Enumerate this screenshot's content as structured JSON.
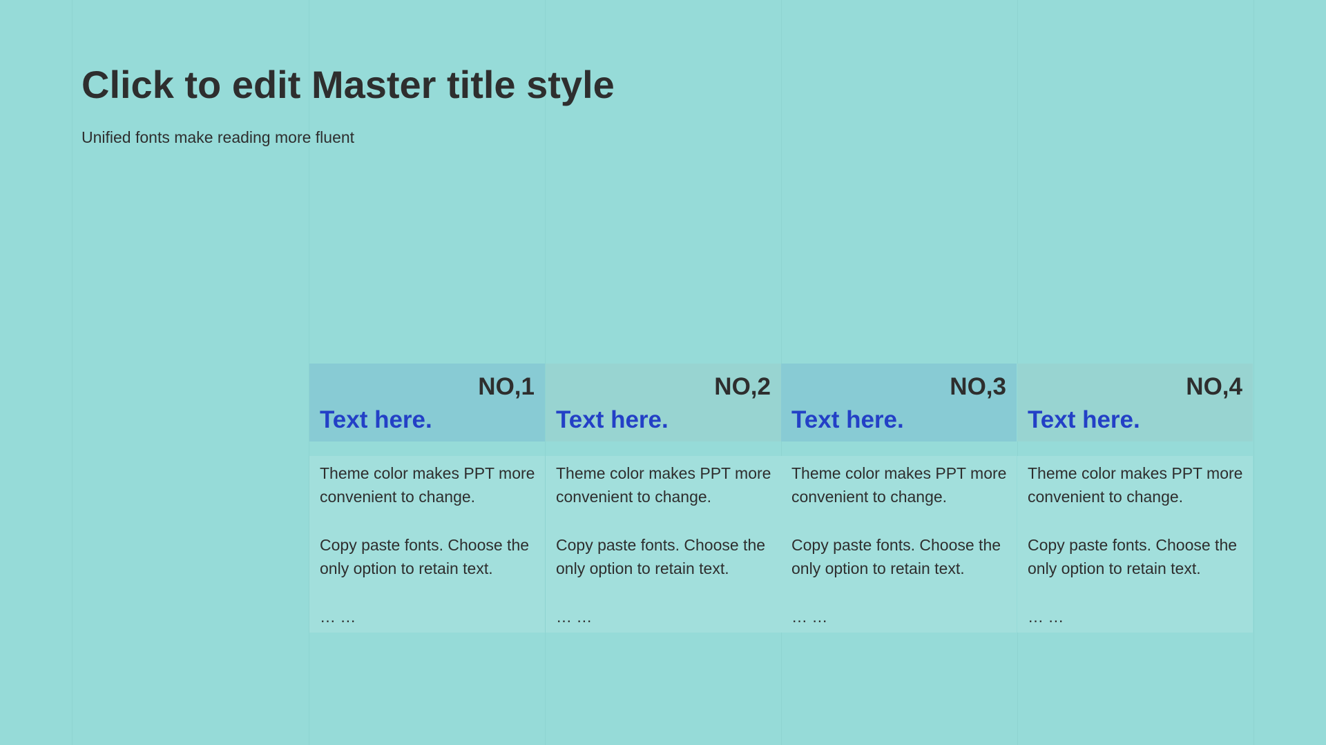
{
  "slide": {
    "title": "Click to edit Master title style",
    "subtitle": "Unified fonts make reading more fluent"
  },
  "cards": [
    {
      "number": "NO,1",
      "heading": "Text here.",
      "paragraph1": "Theme  color makes PPT more convenient to change.",
      "paragraph2": "Copy paste  fonts. Choose the only option to retain text.",
      "ellipsis": "… …"
    },
    {
      "number": "NO,2",
      "heading": "Text here.",
      "paragraph1": "Theme  color makes PPT more convenient to change.",
      "paragraph2": "Copy paste  fonts. Choose the only option to retain text.",
      "ellipsis": "… …"
    },
    {
      "number": "NO,3",
      "heading": "Text here.",
      "paragraph1": "Theme  color makes PPT more convenient to change.",
      "paragraph2": "Copy paste  fonts. Choose the only option to retain text.",
      "ellipsis": "… …"
    },
    {
      "number": "NO,4",
      "heading": "Text here.",
      "paragraph1": "Theme  color makes PPT more convenient to change.",
      "paragraph2": "Copy paste  fonts. Choose the only option to retain text.",
      "ellipsis": "… …"
    }
  ],
  "colors": {
    "background": "#96dbd8",
    "heading_accent": "#2340c6",
    "header_dark": "#88cbd4",
    "header_light": "#98d4d1",
    "body_panel": "#a2dfdc",
    "text": "#2e2e2e"
  }
}
